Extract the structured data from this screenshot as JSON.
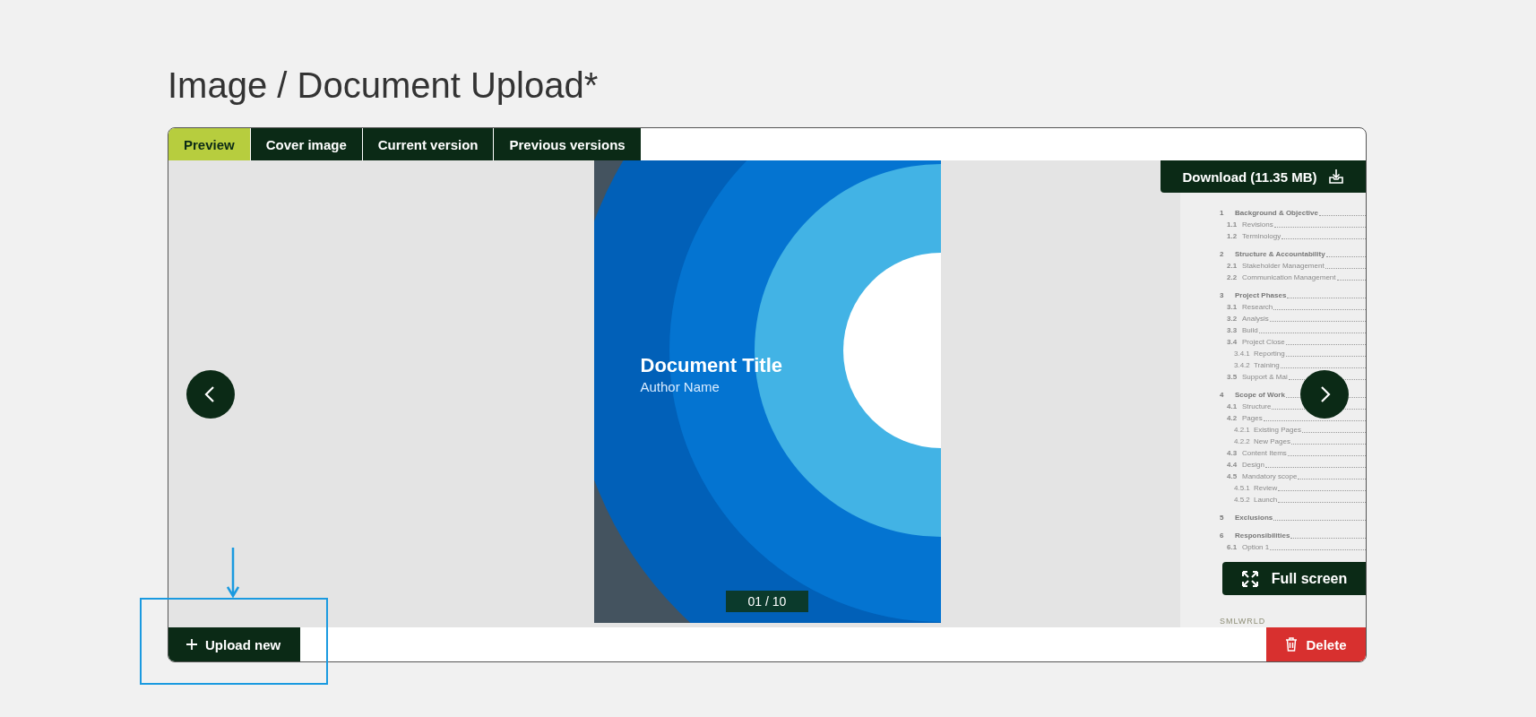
{
  "heading": "Image / Document Upload*",
  "tabs": [
    {
      "label": "Preview",
      "selected": true
    },
    {
      "label": "Cover image",
      "selected": false
    },
    {
      "label": "Current version",
      "selected": false
    },
    {
      "label": "Previous versions",
      "selected": false
    }
  ],
  "download_button": "Download (11.35 MB)",
  "document": {
    "title": "Document Title",
    "author": "Author Name"
  },
  "page_counter": "01 / 10",
  "toc": [
    {
      "number": "1",
      "title": "Background & Objective",
      "children": [
        {
          "number": "1.1",
          "title": "Revisions"
        },
        {
          "number": "1.2",
          "title": "Terminology"
        }
      ]
    },
    {
      "number": "2",
      "title": "Structure & Accountability",
      "children": [
        {
          "number": "2.1",
          "title": "Stakeholder Management"
        },
        {
          "number": "2.2",
          "title": "Communication Management"
        }
      ]
    },
    {
      "number": "3",
      "title": "Project Phases",
      "children": [
        {
          "number": "3.1",
          "title": "Research"
        },
        {
          "number": "3.2",
          "title": "Analysis"
        },
        {
          "number": "3.3",
          "title": "Build"
        },
        {
          "number": "3.4",
          "title": "Project Close",
          "children": [
            {
              "number": "3.4.1",
              "title": "Reporting"
            },
            {
              "number": "3.4.2",
              "title": "Training"
            }
          ]
        },
        {
          "number": "3.5",
          "title": "Support & Mai"
        }
      ]
    },
    {
      "number": "4",
      "title": "Scope of Work",
      "children": [
        {
          "number": "4.1",
          "title": "Structure"
        },
        {
          "number": "4.2",
          "title": "Pages",
          "children": [
            {
              "number": "4.2.1",
              "title": "Existing Pages"
            },
            {
              "number": "4.2.2",
              "title": "New Pages"
            }
          ]
        },
        {
          "number": "4.3",
          "title": "Content Items"
        },
        {
          "number": "4.4",
          "title": "Design"
        },
        {
          "number": "4.5",
          "title": "Mandatory scope",
          "children": [
            {
              "number": "4.5.1",
              "title": "Review"
            },
            {
              "number": "4.5.2",
              "title": "Launch"
            }
          ]
        }
      ]
    },
    {
      "number": "5",
      "title": "Exclusions"
    },
    {
      "number": "6",
      "title": "Responsibilities",
      "children": [
        {
          "number": "6.1",
          "title": "Option 1"
        }
      ]
    }
  ],
  "toc_logo": "SMLWRLD",
  "full_screen_button": "Full screen",
  "upload_button": "Upload new",
  "delete_button": "Delete"
}
